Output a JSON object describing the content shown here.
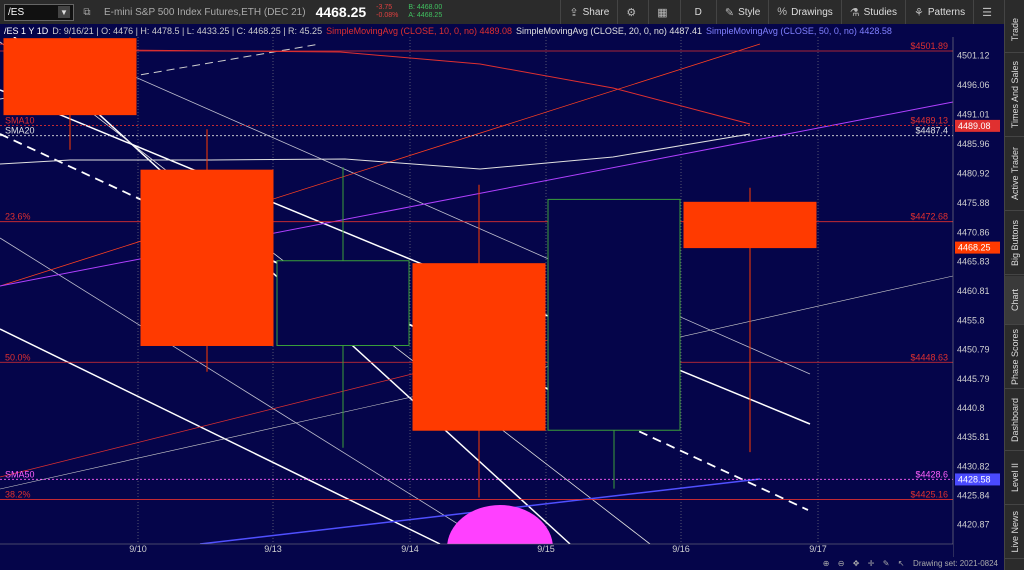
{
  "header": {
    "symbol": "/ES",
    "description": "E-mini S&P 500 Index Futures,ETH (DEC 21)",
    "last": "4468.25",
    "net_change": "-3.75",
    "pct_change": "-0.08%",
    "bid": "B: 4468.00",
    "ask": "A: 4468.25",
    "buttons": {
      "share": "Share",
      "period": "D",
      "style": "Style",
      "drawings": "Drawings",
      "studies": "Studies",
      "patterns": "Patterns"
    }
  },
  "legend": {
    "symbol": "/ES 1 Y 1D",
    "ohlc": "D: 9/16/21 | O: 4476 | H: 4478.5 | L: 4433.25 | C: 4468.25 | R: 45.25",
    "sma10": "SimpleMovingAvg (CLOSE, 10, 0, no)  4489.08",
    "sma20": "SimpleMovingAvg (CLOSE, 20, 0, no)  4487.41",
    "sma50": "SimpleMovingAvg (CLOSE, 50, 0, no)  4428.58"
  },
  "right_tabs": [
    "Trade",
    "Times And Sales",
    "Active Trader",
    "Big Buttons",
    "Chart",
    "Phase Scores",
    "Dashboard",
    "Level II",
    "Live News"
  ],
  "status": {
    "drawing_set": "Drawing set: 2021-0824"
  },
  "chart_data": {
    "type": "candlestick",
    "y_ticks": [
      "4501.12",
      "4496.06",
      "4491.01",
      "4485.96",
      "4480.92",
      "4475.88",
      "4470.86",
      "4465.83",
      "4460.81",
      "4455.8",
      "4450.79",
      "4445.79",
      "4440.8",
      "4435.81",
      "4430.82",
      "4425.84",
      "4420.87"
    ],
    "x_ticks": [
      "9/10",
      "9/13",
      "9/14",
      "9/15",
      "9/16",
      "9/17"
    ],
    "candles": [
      {
        "open": 4504,
        "high": 4504.5,
        "low": 4485,
        "close": 4491,
        "color": "#ff3a00"
      },
      {
        "open": 4481.5,
        "high": 4488.5,
        "low": 4447,
        "close": 4451.5,
        "color": "#ff3a00"
      },
      {
        "open": 4451.5,
        "high": 4482,
        "low": 4434,
        "close": 4466,
        "color": "#05054a"
      },
      {
        "open": 4465.5,
        "high": 4479,
        "low": 4425.5,
        "close": 4437,
        "color": "#ff3a00"
      },
      {
        "open": 4437,
        "high": 4476.5,
        "low": 4427,
        "close": 4476.5,
        "color": "#05054a"
      },
      {
        "open": 4476,
        "high": 4478.5,
        "low": 4433.25,
        "close": 4468.25,
        "color": "#ff3a00"
      }
    ],
    "levels": [
      {
        "label": "",
        "value": 4501.89,
        "text": "$4501.89",
        "color": "#e03030"
      },
      {
        "label": "SMA10",
        "value": 4489.13,
        "text": "$4489.13",
        "color": "#e03030"
      },
      {
        "label": "SMA20",
        "value": 4487.4,
        "text": "$4487.4",
        "color": "#e0e0e0"
      },
      {
        "label": "23.6%",
        "value": 4472.68,
        "text": "$4472.68",
        "color": "#e03030"
      },
      {
        "label": "50.0%",
        "value": 4448.63,
        "text": "$4448.63",
        "color": "#e03030"
      },
      {
        "label": "SMA50",
        "value": 4428.6,
        "text": "$4428.6",
        "color": "#ff60ff"
      },
      {
        "label": "38.2%",
        "value": 4425.16,
        "text": "$4425.16",
        "color": "#e03030"
      }
    ],
    "price_tags": [
      {
        "value": 4489.08,
        "text": "4489.08",
        "bg": "#e03030",
        "fg": "#ffffff"
      },
      {
        "value": 4468.25,
        "text": "4468.25",
        "bg": "#ff3a00",
        "fg": "#ffffff"
      },
      {
        "value": 4428.58,
        "text": "4428.58",
        "bg": "#4a4aff",
        "fg": "#ffffff"
      }
    ]
  }
}
